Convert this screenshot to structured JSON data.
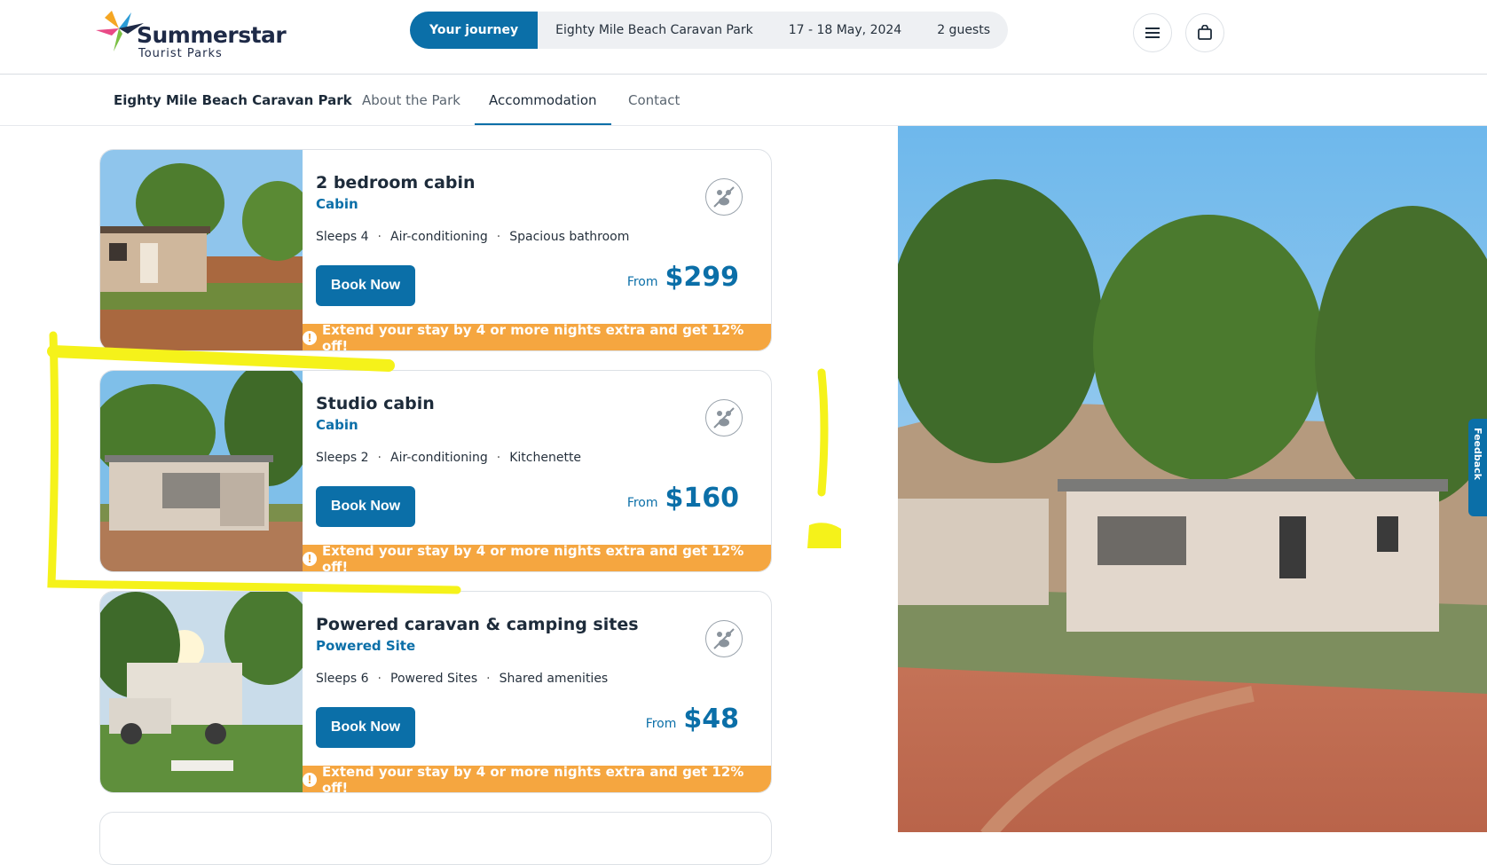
{
  "brand": {
    "name": "Summerstar",
    "sub": "Tourist Parks"
  },
  "journey": {
    "label": "Your journey",
    "park": "Eighty Mile Beach Caravan Park",
    "dates": "17 - 18 May, 2024",
    "guests": "2 guests"
  },
  "header_icons": [
    "menu-icon",
    "bag-icon"
  ],
  "subnav": {
    "park": "Eighty Mile Beach Caravan Park",
    "tabs": [
      "About the Park",
      "Accommodation",
      "Contact"
    ],
    "active_tab": "Accommodation"
  },
  "cards": [
    {
      "title": "2 bedroom cabin",
      "type": "Cabin",
      "features": [
        "Sleeps 4",
        "Air-conditioning",
        "Spacious bathroom"
      ],
      "book": "Book Now",
      "from": "From",
      "price": "$299",
      "promo": "Extend your stay by 4 or more nights extra and get 12% off!"
    },
    {
      "title": "Studio cabin",
      "type": "Cabin",
      "features": [
        "Sleeps 2",
        "Air-conditioning",
        "Kitchenette"
      ],
      "book": "Book Now",
      "from": "From",
      "price": "$160",
      "promo": "Extend your stay by 4 or more nights extra and get 12% off!"
    },
    {
      "title": "Powered caravan & camping sites",
      "type": "Powered Site",
      "features": [
        "Sleeps 6",
        "Powered Sites",
        "Shared amenities"
      ],
      "book": "Book Now",
      "from": "From",
      "price": "$48",
      "promo": "Extend your stay by 4 or more nights extra and get 12% off!"
    }
  ],
  "feedback": "Feedback",
  "colors": {
    "accent": "#0b6fa8",
    "promo": "#f5a640",
    "highlight": "#f5f21a"
  }
}
